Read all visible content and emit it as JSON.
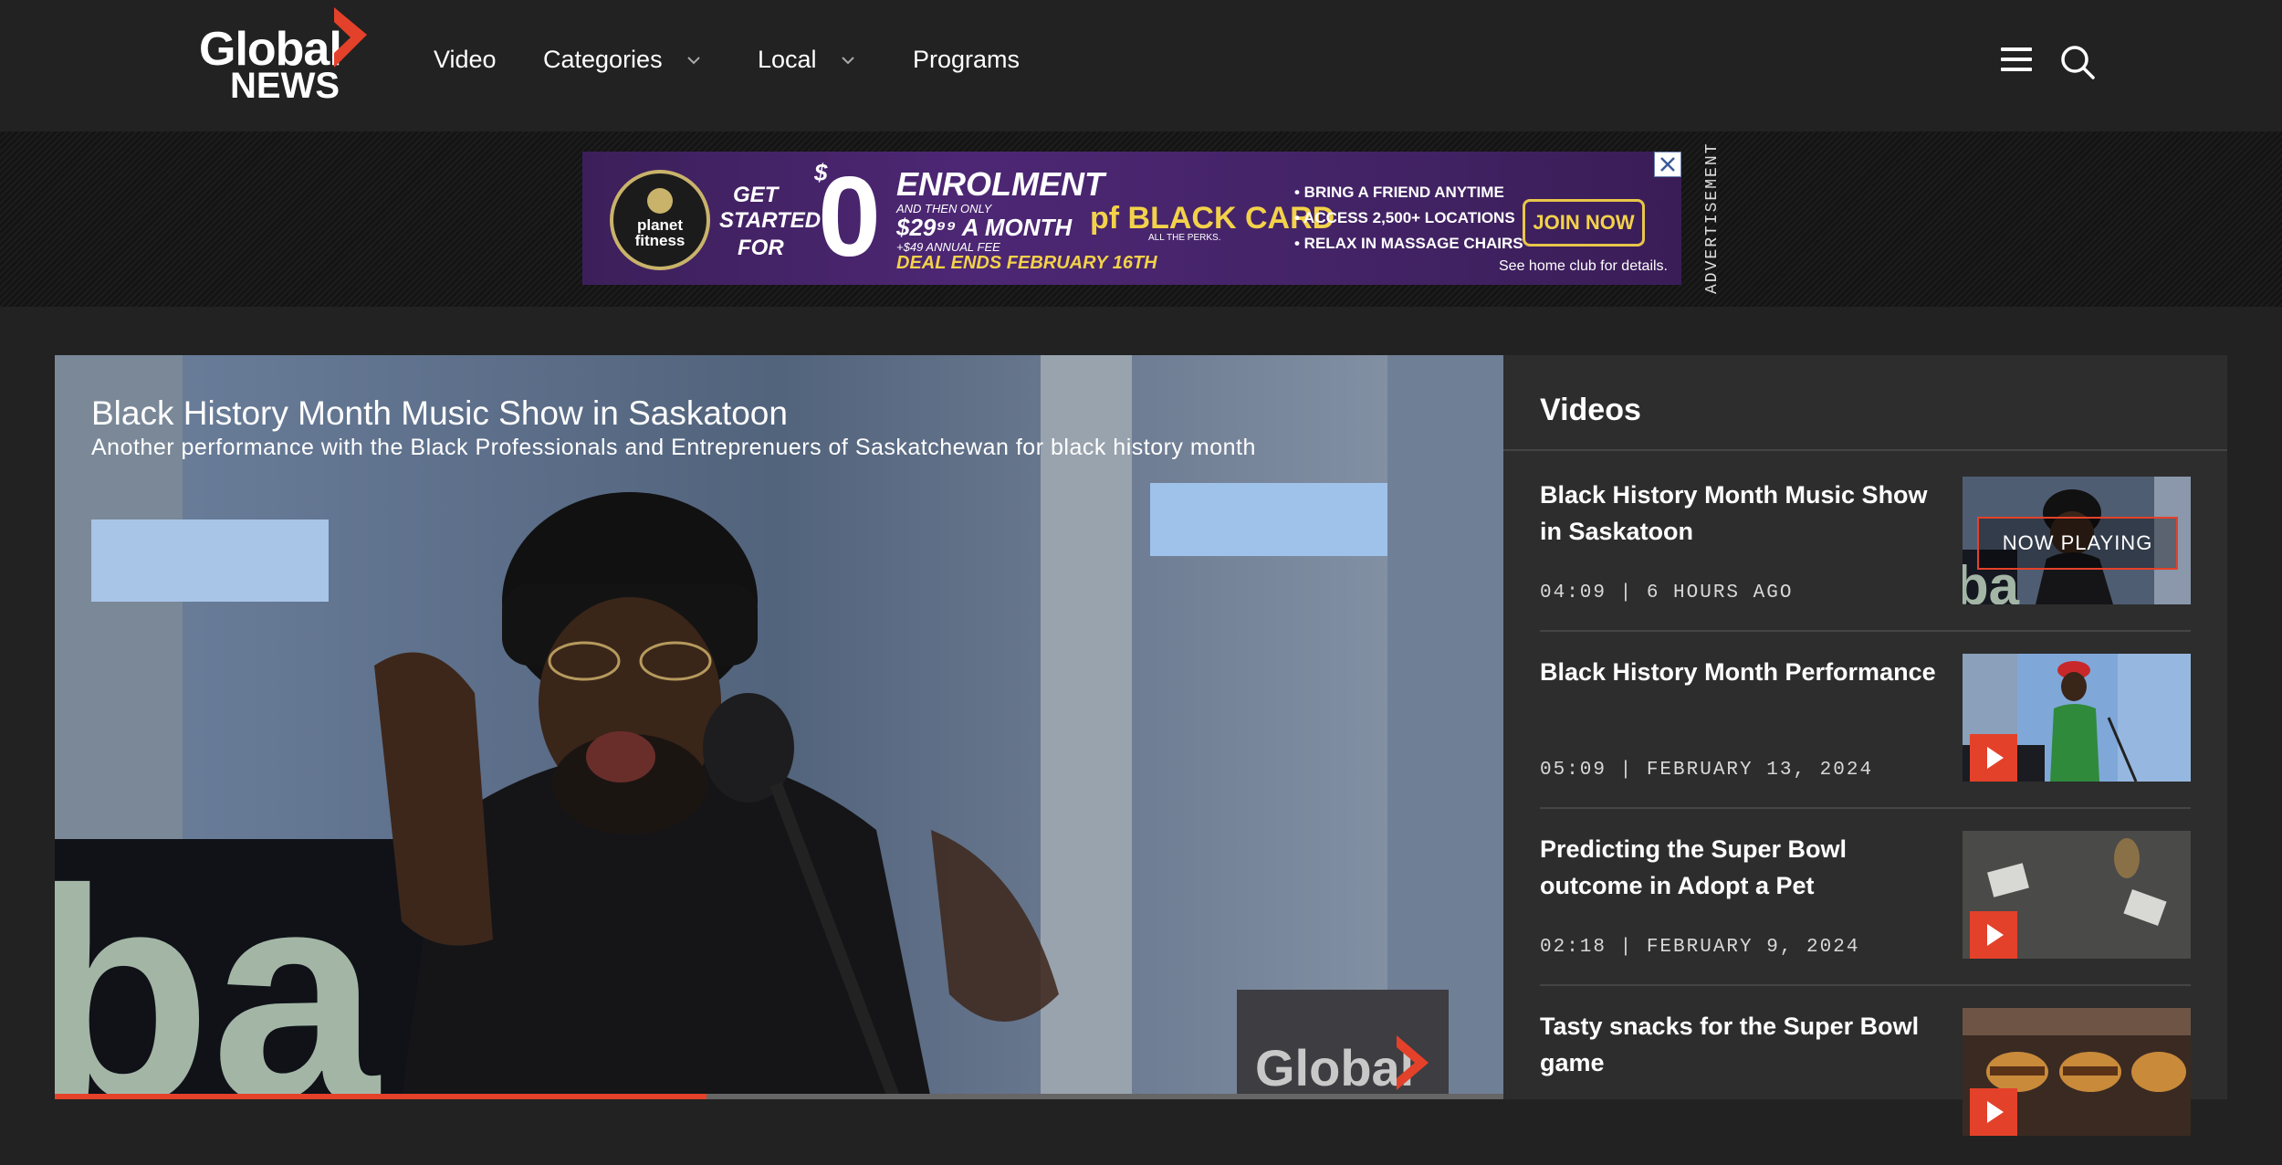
{
  "header": {
    "logo_line1": "Global",
    "logo_line2": "NEWS",
    "nav": [
      {
        "label": "Video"
      },
      {
        "label": "Categories"
      },
      {
        "label": "Local"
      },
      {
        "label": "Programs"
      }
    ],
    "menu_icon": "hamburger-icon",
    "search_icon": "search-icon"
  },
  "ad": {
    "label": "ADVERTISEMENT",
    "brand": "planet fitness",
    "get_started_1": "GET",
    "get_started_2": "STARTED",
    "get_started_3": "FOR",
    "dollar": "$",
    "zero": "0",
    "enrolment": "ENROLMENT",
    "and_then": "AND THEN ONLY",
    "price": "$29⁹⁹ A MONTH",
    "annual": "+$49 ANNUAL FEE",
    "deal": "DEAL ENDS FEBRUARY 16TH",
    "black_card": "pf BLACK CARD",
    "black_card_tag": "ALL THE PERKS.",
    "bullets": [
      "• BRING A FRIEND ANYTIME",
      "• ACCESS 2,500+ LOCATIONS",
      "• RELAX IN MASSAGE CHAIRS"
    ],
    "join": "JOIN NOW",
    "disclaimer": "See home club for details.",
    "close_icon": "close-icon"
  },
  "player": {
    "title": "Black History Month Music Show in Saskatoon",
    "subtitle": "Another performance with the Black Professionals and Entreprenuers of Saskatchewan for black history month",
    "watermark": "Global",
    "progress": 0.45
  },
  "sidebar": {
    "title": "Videos",
    "items": [
      {
        "title": "Black History Month Music Show in Saskatoon",
        "meta": "04:09 | 6 HOURS AGO",
        "badge": "NOW PLAYING"
      },
      {
        "title": "Black History Month Performance",
        "meta": "05:09 | FEBRUARY 13, 2024"
      },
      {
        "title": "Predicting the Super Bowl outcome in Adopt a Pet",
        "meta": "02:18 | FEBRUARY 9, 2024"
      },
      {
        "title": "Tasty snacks for the Super Bowl game",
        "meta": ""
      }
    ]
  },
  "colors": {
    "brand_red": "#e4412a",
    "background": "#222222",
    "sidebar": "#2d2d2d"
  }
}
